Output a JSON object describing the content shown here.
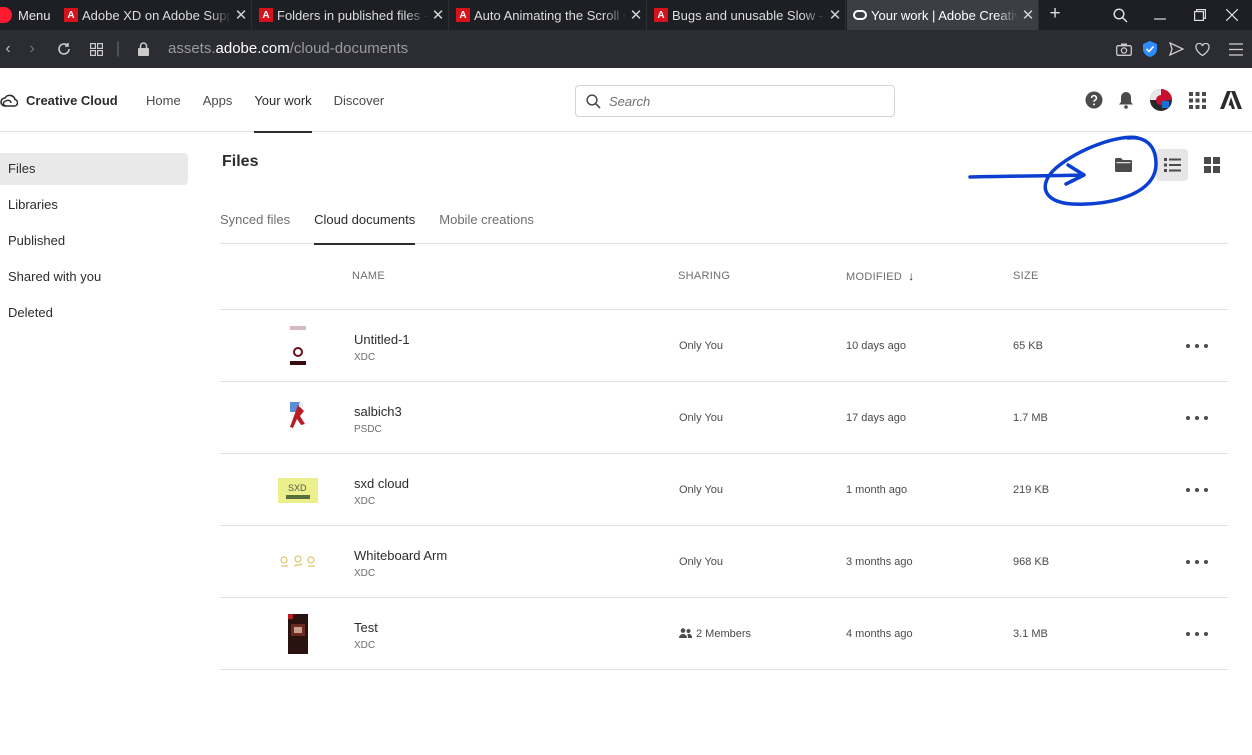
{
  "browser": {
    "menu_label": "Menu",
    "tabs": [
      {
        "title": "Adobe XD on Adobe Support"
      },
      {
        "title": "Folders in published files - Adobe"
      },
      {
        "title": "Auto Animating the Scroll Group"
      },
      {
        "title": "Bugs and unusable Slow - Adobe"
      },
      {
        "title": "Your work | Adobe Creative Cloud"
      }
    ],
    "url_prefix": "assets.",
    "url_domain": "adobe.com",
    "url_path": "/cloud-documents"
  },
  "header": {
    "brand": "Creative Cloud",
    "nav": [
      {
        "label": "Home"
      },
      {
        "label": "Apps"
      },
      {
        "label": "Your work"
      },
      {
        "label": "Discover"
      }
    ],
    "search_placeholder": "Search"
  },
  "sidebar": {
    "items": [
      {
        "label": "Files"
      },
      {
        "label": "Libraries"
      },
      {
        "label": "Published"
      },
      {
        "label": "Shared with you"
      },
      {
        "label": "Deleted"
      }
    ]
  },
  "main": {
    "title": "Files",
    "tabs": [
      {
        "label": "Synced files"
      },
      {
        "label": "Cloud documents"
      },
      {
        "label": "Mobile creations"
      }
    ],
    "columns": {
      "name": "NAME",
      "sharing": "SHARING",
      "modified": "MODIFIED",
      "size": "SIZE"
    },
    "files": [
      {
        "name": "Untitled-1",
        "type": "XDC",
        "sharing": "Only You",
        "modified": "10 days ago",
        "size": "65 KB"
      },
      {
        "name": "salbich3",
        "type": "PSDC",
        "sharing": "Only You",
        "modified": "17 days ago",
        "size": "1.7 MB"
      },
      {
        "name": "sxd cloud",
        "type": "XDC",
        "sharing": "Only You",
        "modified": "1 month ago",
        "size": "219 KB",
        "thumb_text": "SXD"
      },
      {
        "name": "Whiteboard Arm",
        "type": "XDC",
        "sharing": "Only You",
        "modified": "3 months ago",
        "size": "968 KB"
      },
      {
        "name": "Test",
        "type": "XDC",
        "sharing": "2 Members",
        "modified": "4 months ago",
        "size": "3.1 MB"
      }
    ]
  },
  "colors": {
    "annotation_blue": "#0b3fd1",
    "tab_bar": "#1e1f24",
    "address_bar": "#2c2d33",
    "adobe_red": "#d8121a"
  }
}
